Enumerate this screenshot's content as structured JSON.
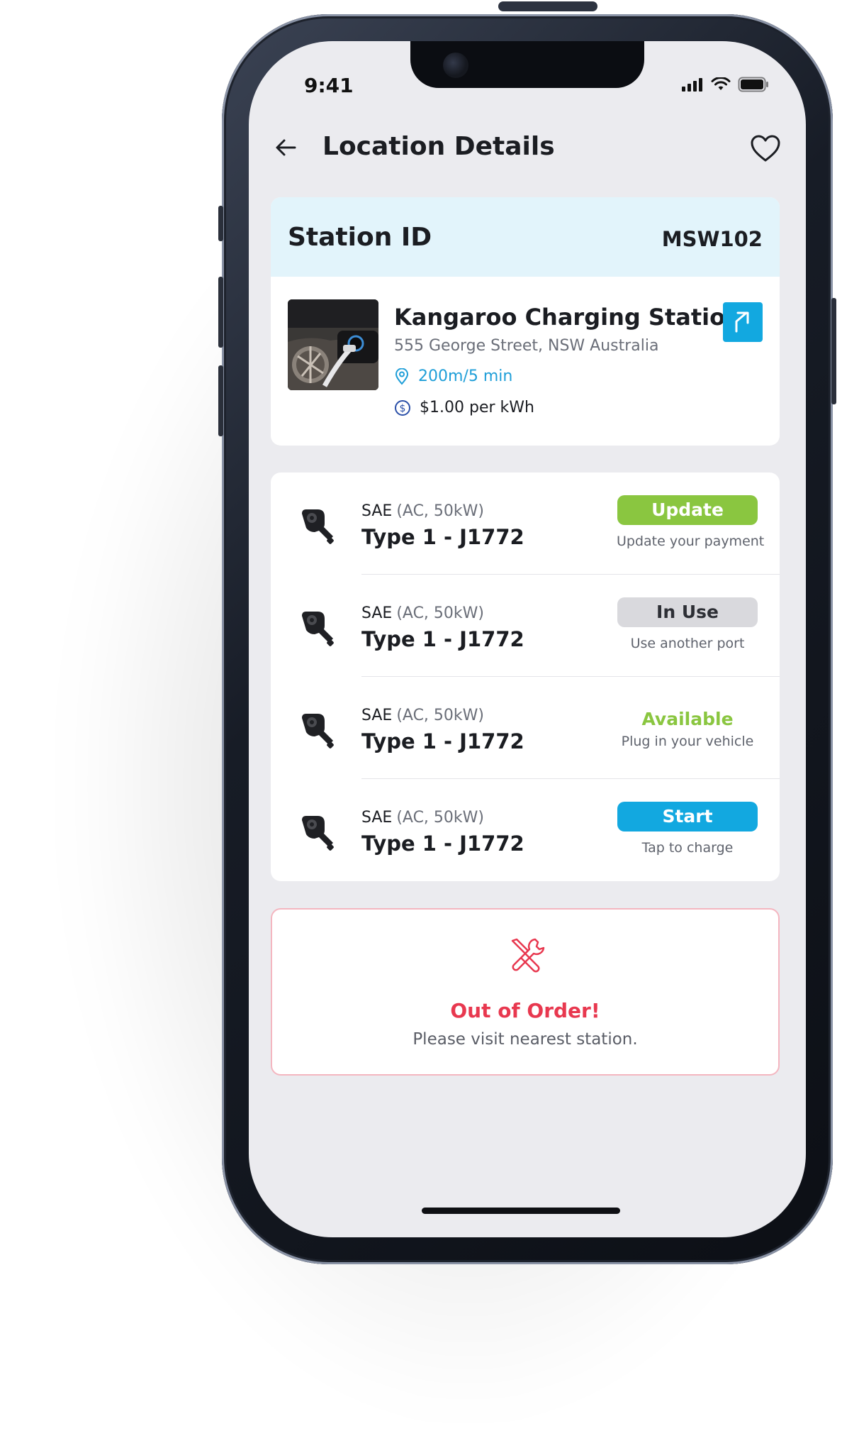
{
  "status_bar": {
    "time": "9:41"
  },
  "header": {
    "title": "Location Details",
    "back_icon": "arrow-left-icon",
    "favorite_icon": "heart-icon"
  },
  "station": {
    "id_label": "Station ID",
    "id_value": "MSW102",
    "name": "Kangaroo Charging Station",
    "address": "555 George Street, NSW Australia",
    "distance": "200m/5 min",
    "price": "$1.00 per kWh",
    "navigate_icon": "arrow-up-right-icon"
  },
  "ports": [
    {
      "standard": "SAE",
      "spec": "(AC, 50kW)",
      "type": "Type 1 - J1772",
      "status": "Update",
      "status_style": "green-button",
      "subtext": "Update your payment"
    },
    {
      "standard": "SAE",
      "spec": "(AC, 50kW)",
      "type": "Type 1 - J1772",
      "status": "In Use",
      "status_style": "grey-badge",
      "subtext": "Use another port"
    },
    {
      "standard": "SAE",
      "spec": "(AC, 50kW)",
      "type": "Type 1 - J1772",
      "status": "Available",
      "status_style": "green-text",
      "subtext": "Plug in your vehicle"
    },
    {
      "standard": "SAE",
      "spec": "(AC, 50kW)",
      "type": "Type 1 - J1772",
      "status": "Start",
      "status_style": "blue-button",
      "subtext": "Tap to charge"
    }
  ],
  "alert": {
    "icon": "tools-icon",
    "title": "Out of Order!",
    "message": "Please visit nearest station."
  },
  "colors": {
    "accent_blue": "#12a8e0",
    "success_green": "#8ac640",
    "error_red": "#e8384f",
    "station_header_bg": "#e2f4fb",
    "screen_bg": "#ebebef"
  }
}
